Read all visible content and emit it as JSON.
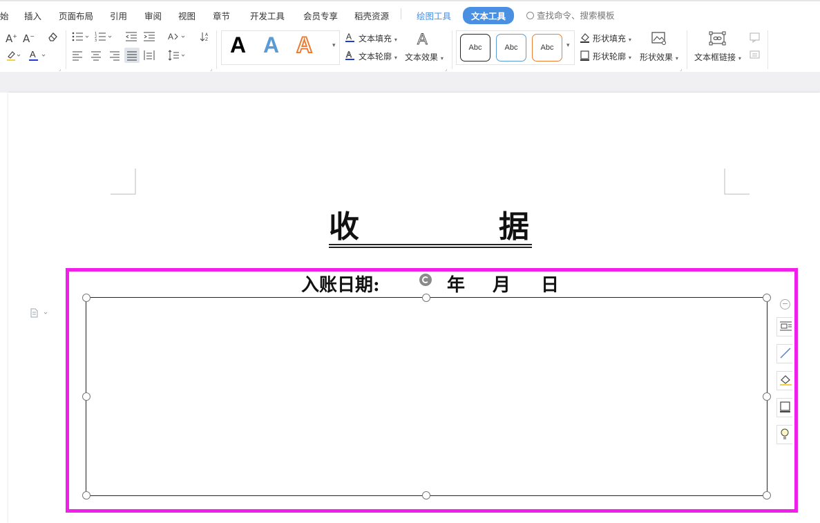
{
  "menu": {
    "items": [
      "始",
      "插入",
      "页面布局",
      "引用",
      "审阅",
      "视图",
      "章节",
      "开发工具",
      "会员专享",
      "稻壳资源"
    ],
    "draw_tools": "绘图工具",
    "text_tools": "文本工具",
    "search_placeholder": "查找命令、搜索模板"
  },
  "ribbon": {
    "text_fill": "文本填充",
    "text_outline": "文本轮廓",
    "text_effect": "文本效果",
    "shape_fill": "形状填充",
    "shape_outline": "形状轮廓",
    "shape_effect": "形状效果",
    "textbox_link": "文本框链接",
    "art_letters": [
      "A",
      "A",
      "A"
    ],
    "style_samples": [
      "Abc",
      "Abc",
      "Abc"
    ]
  },
  "document": {
    "title_char1": "收",
    "title_char2": "据",
    "date_label": "入账日期:",
    "year": "年",
    "month": "月",
    "day": "日"
  },
  "colors": {
    "accent": "#4a90e2",
    "selection_highlight": "#f020ea"
  }
}
